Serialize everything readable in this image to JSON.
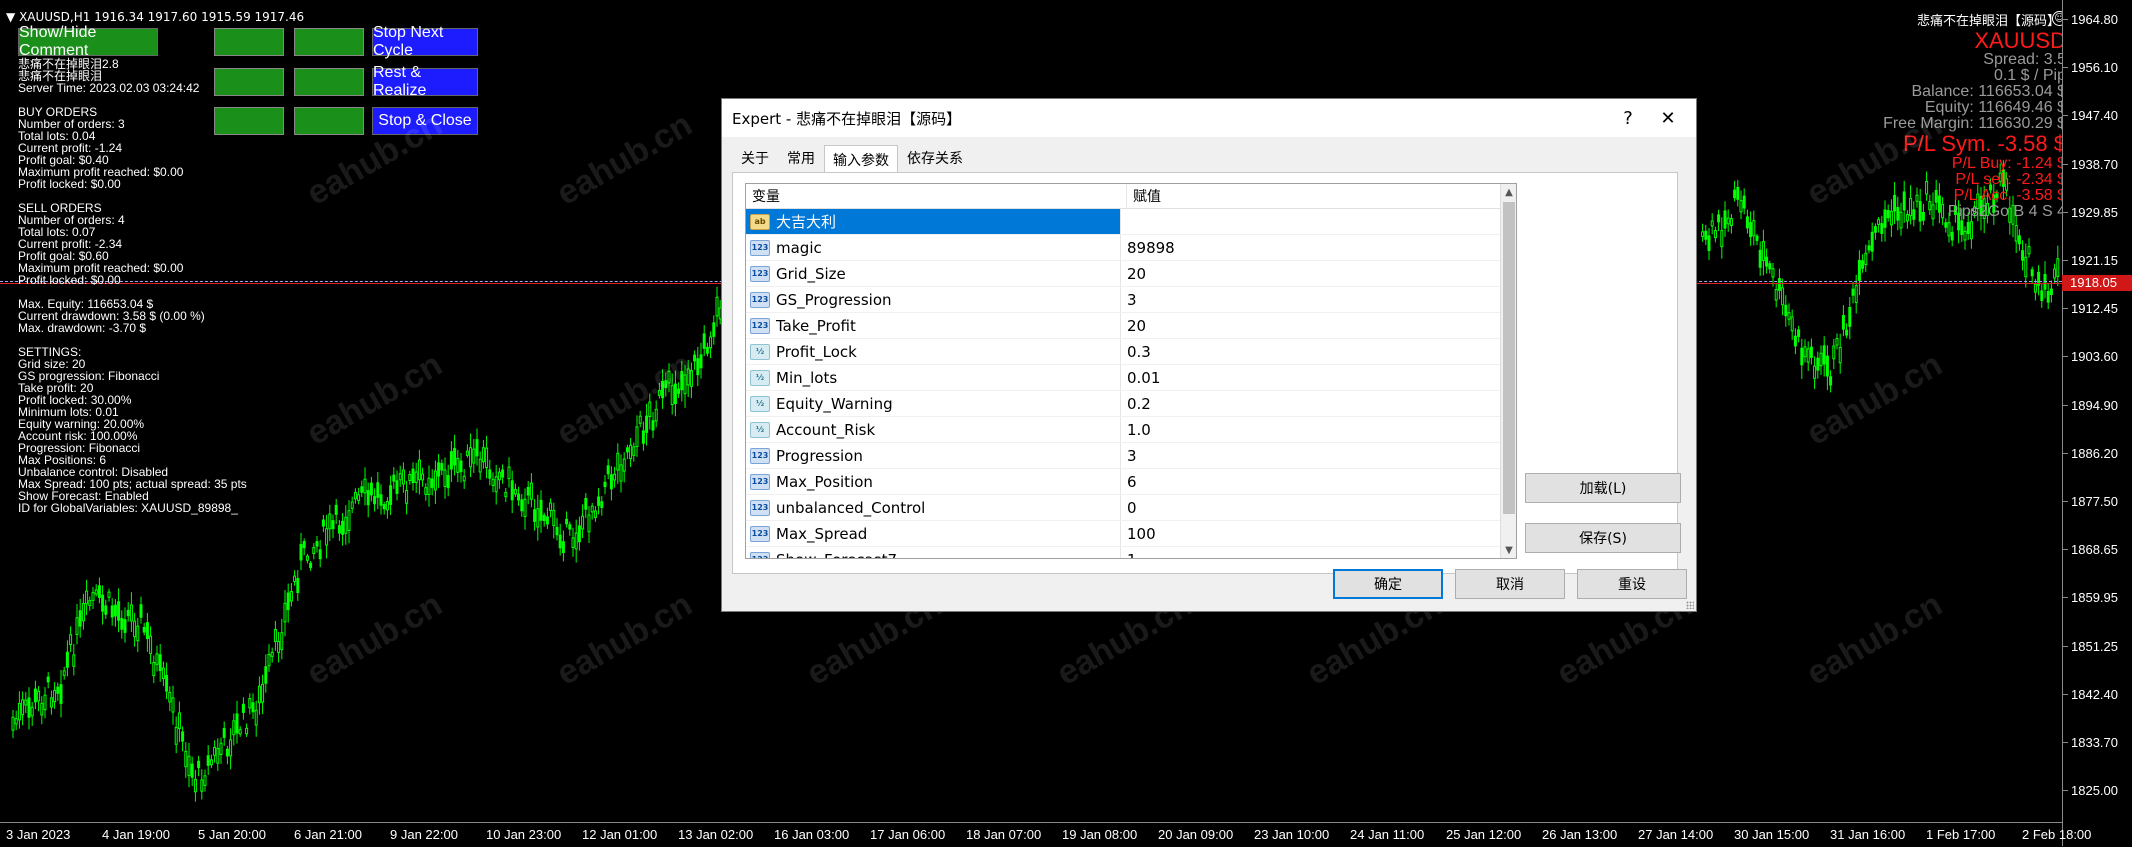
{
  "chart": {
    "symbol_line": "XAUUSD,H1  1916.34 1917.60 1915.59 1917.46",
    "top_right_title": "悲痛不在掉眼泪【源码】",
    "current_price": "1918.05",
    "price_labels": [
      "1964.80",
      "1956.10",
      "1947.40",
      "1938.70",
      "1929.85",
      "1921.15",
      "1912.45",
      "1903.60",
      "1894.90",
      "1886.20",
      "1877.50",
      "1868.65",
      "1859.95",
      "1851.25",
      "1842.40",
      "1833.70",
      "1825.00"
    ],
    "time_labels": [
      "3 Jan 2023",
      "4 Jan 19:00",
      "5 Jan 20:00",
      "6 Jan 21:00",
      "9 Jan 22:00",
      "10 Jan 23:00",
      "12 Jan 01:00",
      "13 Jan 02:00",
      "16 Jan 03:00",
      "17 Jan 06:00",
      "18 Jan 07:00",
      "19 Jan 08:00",
      "20 Jan 09:00",
      "23 Jan 10:00",
      "24 Jan 11:00",
      "25 Jan 12:00",
      "26 Jan 13:00",
      "27 Jan 14:00",
      "30 Jan 15:00",
      "31 Jan 16:00",
      "1 Feb 17:00",
      "2 Feb 18:00"
    ],
    "watermark": "eahub.cn",
    "colors": {
      "candle": "#00ff00",
      "price_marker": "#d01818",
      "bid_line": "#d22222"
    }
  },
  "buttons": {
    "show_hide": "Show/Hide Comment",
    "stop_next": "Stop Next Cycle",
    "rest_realize": "Rest & Realize",
    "stop_close": "Stop & Close"
  },
  "comment_lines": [
    "悲痛不在掉眼泪2.8",
    "悲痛不在掉眼泪",
    "Server Time: 2023.02.03 03:24:42",
    "",
    "BUY ORDERS",
    "Number of orders: 3",
    "Total lots: 0.04",
    "Current profit: -1.24",
    "Profit goal: $0.40",
    "Maximum profit reached: $0.00",
    "Profit locked: $0.00",
    "",
    "SELL ORDERS",
    "Number of orders: 4",
    "Total lots: 0.07",
    "Current profit: -2.34",
    "Profit goal: $0.60",
    "Maximum profit reached: $0.00",
    "Profit locked: $0.00",
    "",
    "Max. Equity: 116653.04 $",
    "Current drawdown: 3.58 $ (0.00 %)",
    "Max. drawdown: -3.70 $",
    "",
    "SETTINGS:",
    "Grid size: 20",
    "GS progression: Fibonacci",
    "Take profit: 20",
    "Profit locked: 30.00%",
    "Minimum lots: 0.01",
    "Equity warning: 20.00%",
    "Account risk: 100.00%",
    "Progression: Fibonacci",
    "Max Positions: 6",
    "Unbalance control: Disabled",
    "Max Spread: 100 pts; actual spread: 35 pts",
    "Show Forecast: Enabled",
    "ID for GlobalVariables: XAUUSD_89898_"
  ],
  "right_info": {
    "symbol": "XAUUSD",
    "spread": "Spread: 3.5",
    "pip": "0.1 $ / Pip",
    "balance": "Balance: 116653.04 $",
    "equity": "Equity: 116649.46 $",
    "free_margin": "Free Margin: 116630.29 $",
    "pl_sym": "P/L Sym. -3.58 $",
    "pl_buy": "P/L Buy: -1.24 $",
    "pl_sell": "P/L sell: -2.34 $",
    "pl_acc": "P/L Acc. -3.58 $",
    "pips2go": "Pips2Go B 4 S 4"
  },
  "dialog": {
    "title": "Expert - 悲痛不在掉眼泪【源码】",
    "help": "?",
    "close": "✕",
    "tabs": [
      "关于",
      "常用",
      "输入参数",
      "依存关系"
    ],
    "active_tab": 2,
    "col_variable": "变量",
    "col_value": "赋值",
    "rows": [
      {
        "icon": "ab",
        "name": "大吉大利",
        "value": "",
        "selected": true
      },
      {
        "icon": "123",
        "name": "magic",
        "value": "89898"
      },
      {
        "icon": "123",
        "name": "Grid_Size",
        "value": "20"
      },
      {
        "icon": "123",
        "name": "GS_Progression",
        "value": "3"
      },
      {
        "icon": "123",
        "name": "Take_Profit",
        "value": "20"
      },
      {
        "icon": "v2",
        "name": "Profit_Lock",
        "value": "0.3"
      },
      {
        "icon": "v2",
        "name": "Min_lots",
        "value": "0.01"
      },
      {
        "icon": "v2",
        "name": "Equity_Warning",
        "value": "0.2"
      },
      {
        "icon": "v2",
        "name": "Account_Risk",
        "value": "1.0"
      },
      {
        "icon": "123",
        "name": "Progression",
        "value": "3"
      },
      {
        "icon": "123",
        "name": "Max_Position",
        "value": "6"
      },
      {
        "icon": "123",
        "name": "unbalanced_Control",
        "value": "0"
      },
      {
        "icon": "123",
        "name": "Max_Spread",
        "value": "100"
      },
      {
        "icon": "123",
        "name": "Show_Forecast7",
        "value": "1"
      }
    ],
    "load_btn": "加载(L)",
    "save_btn": "保存(S)",
    "ok_btn": "确定",
    "cancel_btn": "取消",
    "reset_btn": "重设"
  }
}
